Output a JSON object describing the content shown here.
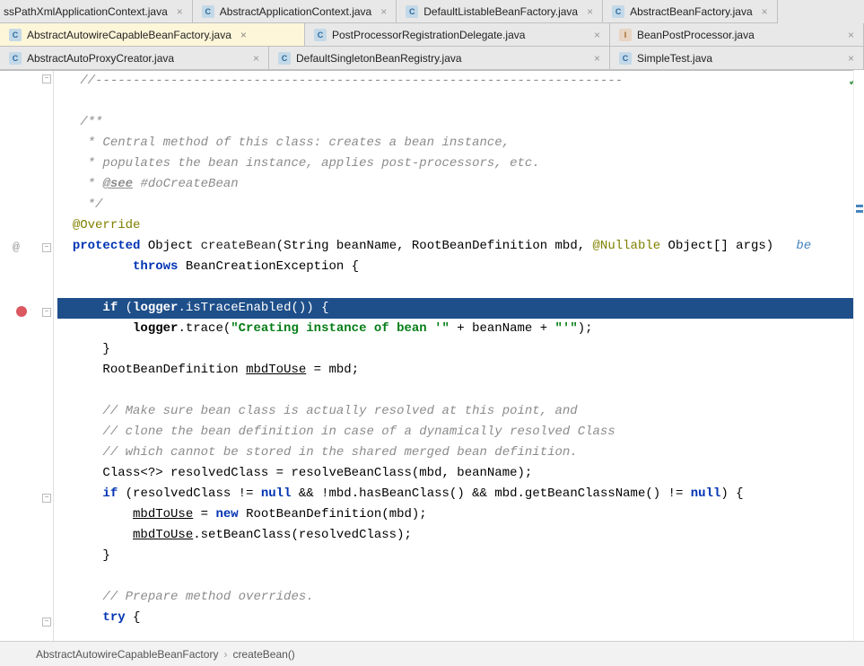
{
  "tabs_row1": [
    {
      "label": "ssPathXmlApplicationContext.java",
      "icon": "C",
      "active": false,
      "truncated": true
    },
    {
      "label": "AbstractApplicationContext.java",
      "icon": "C",
      "active": false
    },
    {
      "label": "DefaultListableBeanFactory.java",
      "icon": "C",
      "active": false
    },
    {
      "label": "AbstractBeanFactory.java",
      "icon": "C",
      "active": false
    }
  ],
  "tabs_row2": [
    {
      "label": "AbstractAutowireCapableBeanFactory.java",
      "icon": "C",
      "active": true
    },
    {
      "label": "PostProcessorRegistrationDelegate.java",
      "icon": "C",
      "active": false
    },
    {
      "label": "BeanPostProcessor.java",
      "icon": "I",
      "active": false
    }
  ],
  "tabs_row3": [
    {
      "label": "AbstractAutoProxyCreator.java",
      "icon": "C",
      "active": false
    },
    {
      "label": "DefaultSingletonBeanRegistry.java",
      "icon": "C",
      "active": false
    },
    {
      "label": "SimpleTest.java",
      "icon": "C",
      "active": false
    }
  ],
  "code": {
    "dash": "//----------------------------------------------------------------------",
    "doc1": "/**",
    "doc2": " * Central method of this class: creates a bean instance,",
    "doc3": " * populates the bean instance, applies post-processors, etc.",
    "doc4_a": " * ",
    "doc4_see": "@see",
    "doc4_b": " #doCreateBean",
    "doc5": " */",
    "override": "@Override",
    "sig_a": "protected",
    "sig_b": " Object ",
    "sig_fn": "createBean",
    "sig_c": "(String beanName, RootBeanDefinition mbd, ",
    "sig_ann": "@Nullable",
    "sig_d": " Object[] args)   ",
    "sig_hint": "be",
    "throws_a": "throws",
    "throws_b": " BeanCreationException {",
    "if_a": "if",
    "if_b": " (",
    "if_c": "logger",
    "if_d": ".isTraceEnabled()) {",
    "trace_a": "logger",
    "trace_b": ".trace(",
    "trace_str": "\"Creating instance of bean '\"",
    "trace_c": " + beanName + ",
    "trace_str2": "\"'\"",
    "trace_d": ");",
    "close1": "}",
    "mbd_a": "RootBeanDefinition ",
    "mbd_u": "mbdToUse",
    "mbd_b": " = mbd;",
    "c1": "// Make sure bean class is actually resolved at this point, and",
    "c2": "// clone the bean definition in case of a dynamically resolved Class",
    "c3": "// which cannot be stored in the shared merged bean definition.",
    "res_a": "Class<?> resolvedClass = resolveBeanClass(mbd, beanName);",
    "if2_a": "if",
    "if2_b": " (resolvedClass != ",
    "if2_null": "null",
    "if2_c": " && !mbd.hasBeanClass() && mbd.getBeanClassName() != ",
    "if2_d": ") {",
    "asn_a": "mbdToUse",
    "asn_b": " = ",
    "asn_new": "new",
    "asn_c": " RootBeanDefinition(mbd);",
    "set_a": "mbdToUse",
    "set_b": ".setBeanClass(resolvedClass);",
    "close2": "}",
    "c4": "// Prepare method overrides.",
    "try_a": "try",
    "try_b": " {"
  },
  "gutter": {
    "override_glyph": "@"
  },
  "breadcrumb": {
    "a": "AbstractAutowireCapableBeanFactory",
    "b": "createBean()"
  }
}
